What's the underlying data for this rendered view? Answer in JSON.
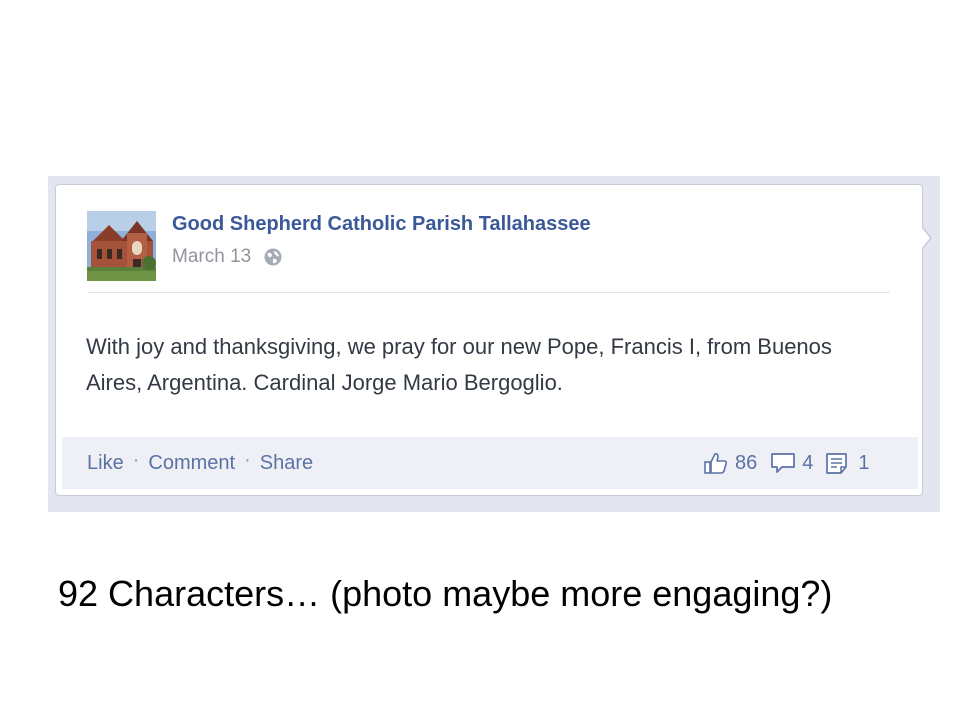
{
  "post": {
    "page_name": "Good Shepherd Catholic Parish Tallahassee",
    "date": "March 13",
    "audience_icon": "globe-icon",
    "text": "With joy and thanksgiving, we pray for our new Pope, Francis I, from Buenos Aires, Argentina. Cardinal Jorge Mario Bergoglio.",
    "actions": {
      "like_label": "Like",
      "comment_label": "Comment",
      "share_label": "Share",
      "separator": "·"
    },
    "counts": {
      "likes": "86",
      "likes_icon": "thumbs-up-icon",
      "comments": "4",
      "comments_icon": "comment-bubble-icon",
      "shares": "1",
      "shares_icon": "share-page-icon"
    }
  },
  "caption": "92 Characters… (photo maybe more engaging?)",
  "colors": {
    "link_blue": "#3b5998",
    "action_blue": "#5c72a6",
    "meta_gray": "#90949c",
    "action_bar_bg": "#eef0f5",
    "frame_bg": "#e3e6ee"
  }
}
